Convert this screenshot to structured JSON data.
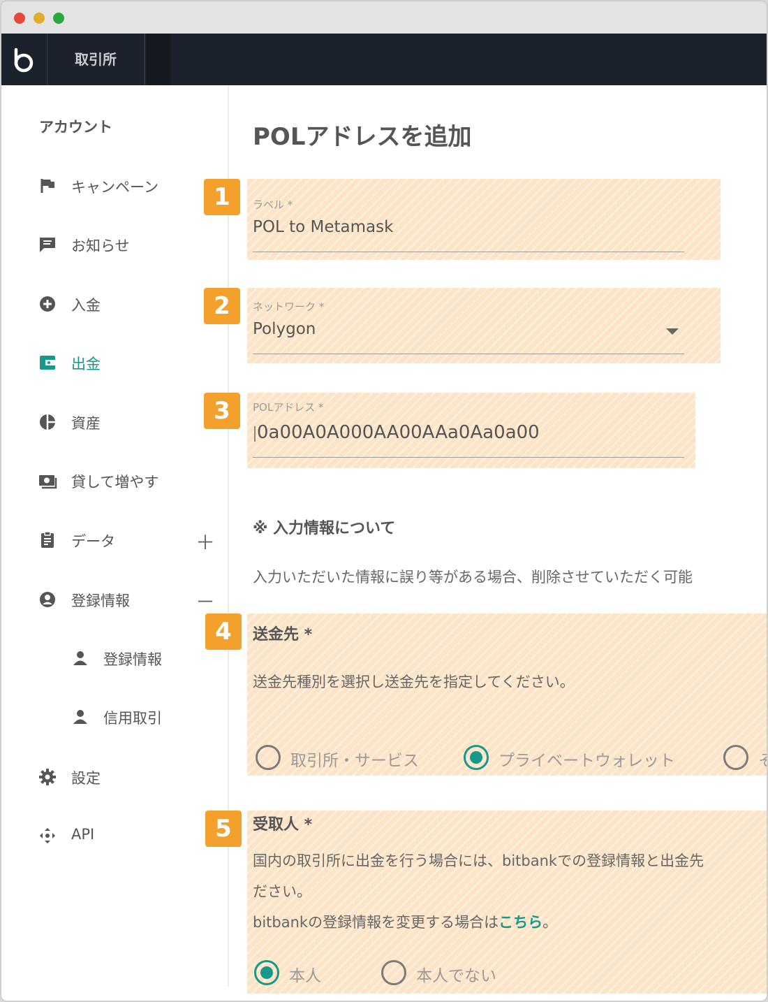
{
  "header": {
    "exchange_tab": "取引所"
  },
  "sidebar": {
    "heading": "アカウント",
    "items": [
      {
        "label": "キャンペーン",
        "icon": "flag-icon"
      },
      {
        "label": "お知らせ",
        "icon": "message-icon"
      },
      {
        "label": "入金",
        "icon": "plus-circle-icon"
      },
      {
        "label": "出金",
        "icon": "wallet-icon",
        "active": true
      },
      {
        "label": "資産",
        "icon": "pie-chart-icon"
      },
      {
        "label": "貸して増やす",
        "icon": "money-icon"
      },
      {
        "label": "データ",
        "icon": "clipboard-icon",
        "toggle": "＋"
      },
      {
        "label": "登録情報",
        "icon": "account-circle-icon",
        "toggle": "－"
      }
    ],
    "sub_items": [
      {
        "label": "登録情報",
        "icon": "person-icon"
      },
      {
        "label": "信用取引",
        "icon": "person-icon"
      }
    ],
    "bottom_items": [
      {
        "label": "設定",
        "icon": "gear-icon"
      },
      {
        "label": "API",
        "icon": "api-icon"
      }
    ]
  },
  "main": {
    "title": "POLアドレスを追加",
    "badges": [
      "1",
      "2",
      "3",
      "4",
      "5"
    ],
    "label_field": {
      "label": "ラベル *",
      "value": "POL to Metamask"
    },
    "network_field": {
      "label": "ネットワーク *",
      "value": "Polygon"
    },
    "address_field": {
      "label": "POLアドレス *",
      "value": "0a00A0A000AA00AAa0Aa0a00"
    },
    "info_heading": "※ 入力情報について",
    "info_text": "入力いただいた情報に誤り等がある場合、削除させていただく可能",
    "destination": {
      "heading": "送金先 *",
      "description": "送金先種別を選択し送金先を指定してください。",
      "options": [
        "取引所・サービス",
        "プライベートウォレット",
        "そ"
      ],
      "selected": "プライベートウォレット"
    },
    "recipient": {
      "heading": "受取人 *",
      "line1": "国内の取引所に出金を行う場合には、bitbankでの登録情報と出金先",
      "line2": "ださい。",
      "line3_prefix": "bitbankの登録情報を変更する場合は",
      "line3_link": "こちら",
      "line3_suffix": "。",
      "options": [
        "本人",
        "本人でない"
      ],
      "selected": "本人"
    }
  },
  "colors": {
    "accent": "#15998b",
    "badge": "#f4a02c",
    "highlight": "#fde4c6",
    "header_bg": "#1c222b"
  }
}
